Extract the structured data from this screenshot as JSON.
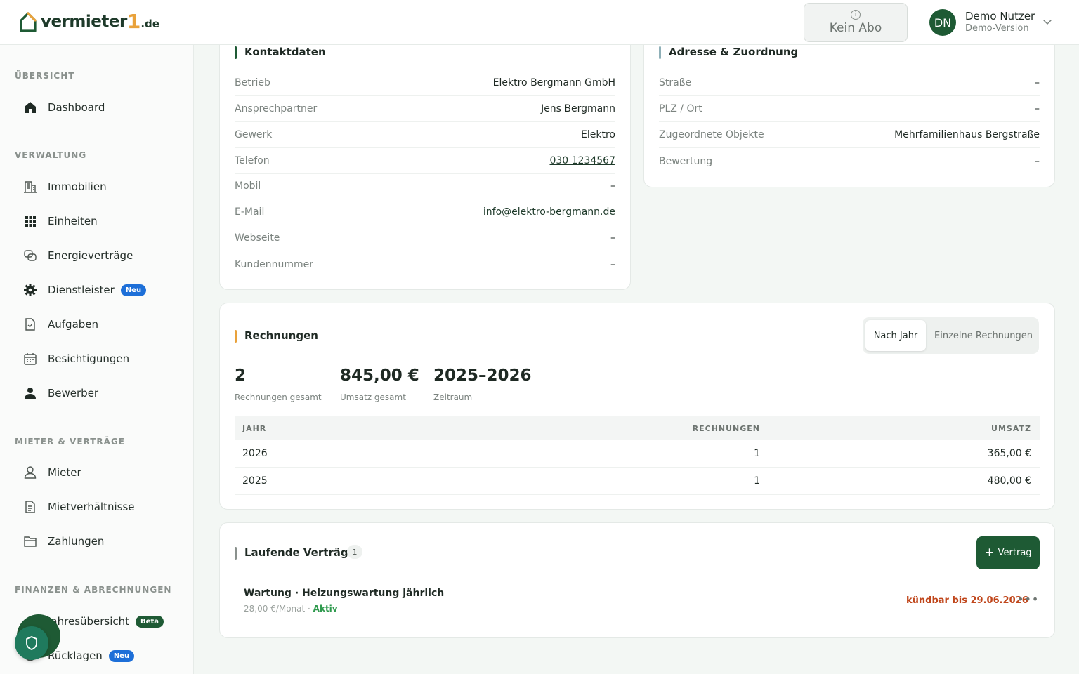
{
  "header": {
    "logo": {
      "text": "vermieter",
      "one": "1",
      "tld": ".de"
    },
    "abo_label": "Kein Abo",
    "abo_icon": "info-icon",
    "user": {
      "initials": "DN",
      "name": "Demo Nutzer",
      "subtitle": "Demo-Version"
    }
  },
  "sidebar": {
    "sections": [
      {
        "title": "ÜBERSICHT"
      },
      {
        "title": "VERWALTUNG"
      },
      {
        "title": "MIETER & VERTRÄGE"
      },
      {
        "title": "FINANZEN & ABRECHNUNGEN"
      }
    ],
    "items": [
      {
        "label": "Dashboard",
        "icon": "home-icon"
      },
      {
        "label": "Immobilien",
        "icon": "building-icon"
      },
      {
        "label": "Einheiten",
        "icon": "grid-icon"
      },
      {
        "label": "Energieverträge",
        "icon": "energy-icon"
      },
      {
        "label": "Dienstleister",
        "icon": "gear-icon",
        "badge": "Neu"
      },
      {
        "label": "Aufgaben",
        "icon": "task-icon"
      },
      {
        "label": "Besichtigungen",
        "icon": "calendar-icon"
      },
      {
        "label": "Bewerber",
        "icon": "person-filled-icon"
      },
      {
        "label": "Mieter",
        "icon": "person-icon"
      },
      {
        "label": "Mietverhältnisse",
        "icon": "document-icon"
      },
      {
        "label": "Zahlungen",
        "icon": "folder-icon"
      },
      {
        "label": "Jahresübersicht",
        "icon": "chart-icon",
        "badge": "Beta"
      },
      {
        "label": "Rücklagen",
        "icon": "piggy-icon",
        "badge": "Neu"
      }
    ]
  },
  "kontakt": {
    "title": "Kontaktdaten",
    "rows": [
      {
        "key": "Betrieb",
        "value": "Elektro Bergmann GmbH"
      },
      {
        "key": "Ansprechpartner",
        "value": "Jens Bergmann"
      },
      {
        "key": "Gewerk",
        "value": "Elektro"
      },
      {
        "key": "Telefon",
        "value": "030 1234567"
      },
      {
        "key": "Mobil",
        "value": "–"
      },
      {
        "key": "E-Mail",
        "value": "info@elektro-bergmann.de"
      },
      {
        "key": "Webseite",
        "value": "–"
      },
      {
        "key": "Kundennummer",
        "value": "–"
      }
    ]
  },
  "adresse": {
    "title": "Adresse & Zuordnung",
    "rows": [
      {
        "key": "Straße",
        "value": "–"
      },
      {
        "key": "PLZ / Ort",
        "value": "–"
      },
      {
        "key": "Zugeordnete Objekte",
        "value": "Mehrfamilienhaus Bergstraße"
      },
      {
        "key": "Bewertung",
        "value": "–"
      }
    ]
  },
  "rechnungen": {
    "title": "Rechnungen",
    "toggle": {
      "active": "Nach Jahr",
      "other": "Einzelne Rechnungen"
    },
    "stats": [
      {
        "value": "2",
        "label": "Rechnungen gesamt"
      },
      {
        "value": "845,00 €",
        "label": "Umsatz gesamt"
      },
      {
        "value": "2025–2026",
        "label": "Zeitraum"
      }
    ],
    "columns": [
      "JAHR",
      "RECHNUNGEN",
      "UMSATZ"
    ],
    "rows": [
      {
        "jahr": "2026",
        "rechnungen": "1",
        "umsatz": "365,00 €"
      },
      {
        "jahr": "2025",
        "rechnungen": "1",
        "umsatz": "480,00 €"
      }
    ]
  },
  "vertraege": {
    "title": "Laufende Verträge",
    "count": "1",
    "add_label": "Vertrag",
    "items": [
      {
        "title": "Wartung · Heizungswartung jährlich",
        "price": "28,00 €/Monat ·",
        "status": "Aktiv",
        "notice": "kündbar bis 29.06.2026"
      }
    ]
  },
  "colors": {
    "brand": "#1e5a34",
    "accent_orange": "#e9a23b",
    "badge_blue": "#1d6fd8",
    "notice_red": "#c0461b",
    "active_green": "#2f9a4e"
  }
}
